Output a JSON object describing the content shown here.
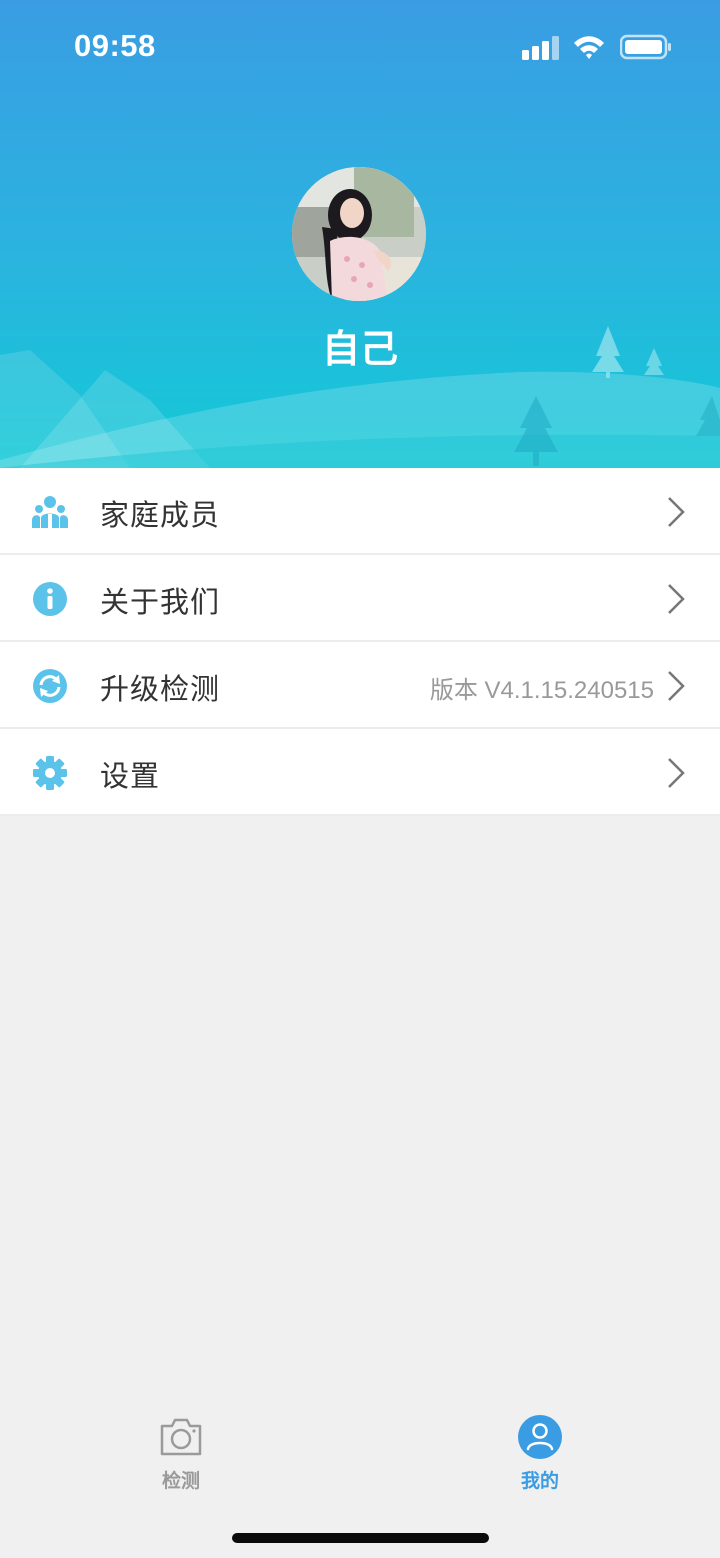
{
  "status_bar": {
    "time": "09:58"
  },
  "profile": {
    "name": "自己"
  },
  "menu": [
    {
      "label": "家庭成员",
      "value": "",
      "icon": "family-icon"
    },
    {
      "label": "关于我们",
      "value": "",
      "icon": "info-icon"
    },
    {
      "label": "升级检测",
      "value": "版本 V4.1.15.240515",
      "icon": "refresh-icon"
    },
    {
      "label": "设置",
      "value": "",
      "icon": "gear-icon"
    }
  ],
  "tabbar": {
    "tabs": [
      {
        "label": "检测",
        "icon": "camera-icon",
        "active": false
      },
      {
        "label": "我的",
        "icon": "profile-icon",
        "active": true
      }
    ]
  },
  "colors": {
    "header_top": "#3a9de3",
    "header_bottom": "#13c9d6",
    "icon_accent": "#5bc3ea",
    "tab_active": "#3a9de3",
    "tab_inactive": "#9a9a9a"
  }
}
